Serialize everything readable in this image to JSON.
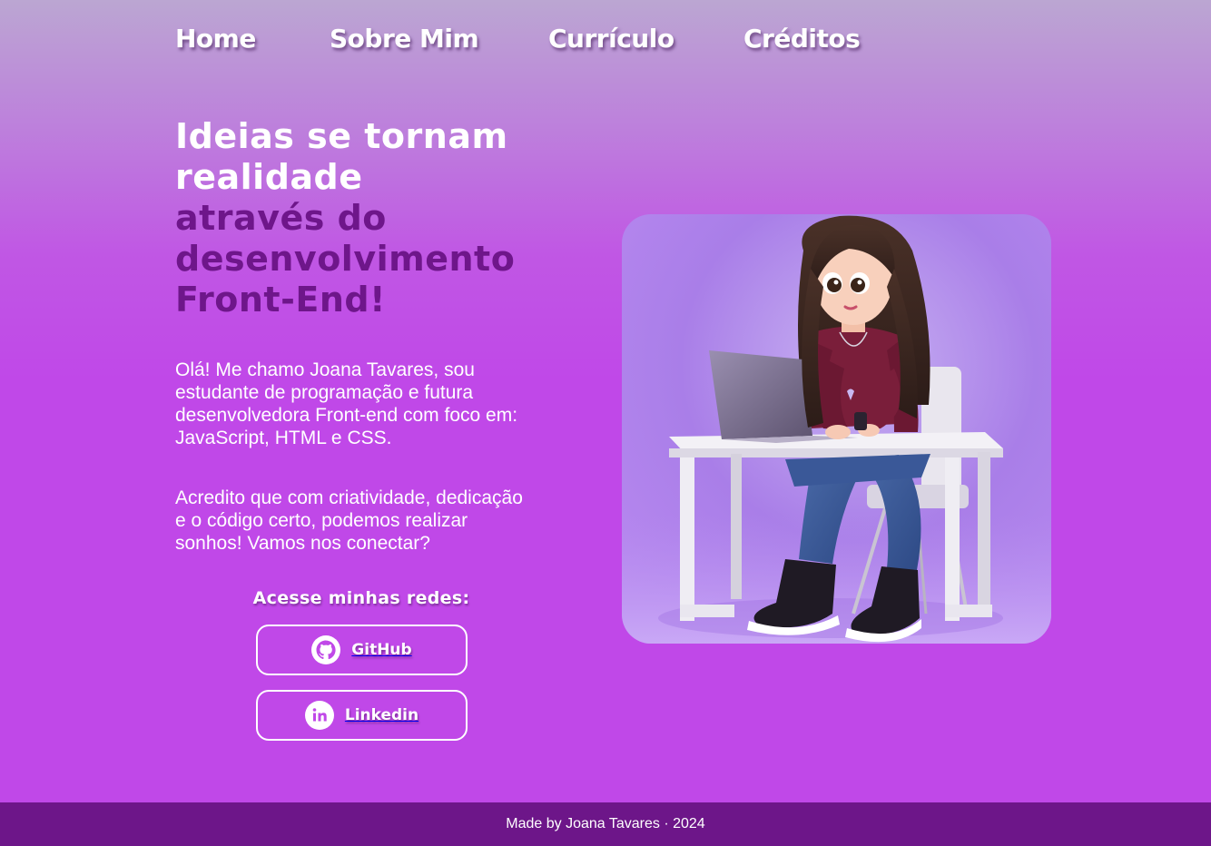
{
  "nav": {
    "items": [
      {
        "label": "Home"
      },
      {
        "label": "Sobre Mim"
      },
      {
        "label": "Currículo"
      },
      {
        "label": "Créditos"
      }
    ]
  },
  "hero": {
    "headline_white_1": "Ideias se tornam",
    "headline_white_2": "realidade",
    "headline_purple_1": "através do",
    "headline_purple_2": "desenvolvimento",
    "headline_purple_3": "Front-End!",
    "paragraph_1": "Olá! Me chamo Joana Tavares, sou estudante de programação e futura desenvolvedora Front-end com foco em: JavaScript, HTML e CSS.",
    "paragraph_2": "Acredito que com criatividade, dedicação e o código certo, podemos realizar sonhos! Vamos nos conectar?"
  },
  "social": {
    "title": "Acesse minhas redes:",
    "buttons": [
      {
        "label": "GitHub",
        "icon": "github-icon"
      },
      {
        "label": "Linkedin",
        "icon": "linkedin-icon"
      }
    ]
  },
  "illustration": {
    "subject": "cartoon-girl-with-laptop"
  },
  "footer": {
    "text": "Made by Joana Tavares · 2024"
  },
  "colors": {
    "accent_purple": "#6e168a",
    "background_purple": "#c048e8",
    "footer_purple": "#6d1689",
    "text_white": "#ffffff"
  }
}
